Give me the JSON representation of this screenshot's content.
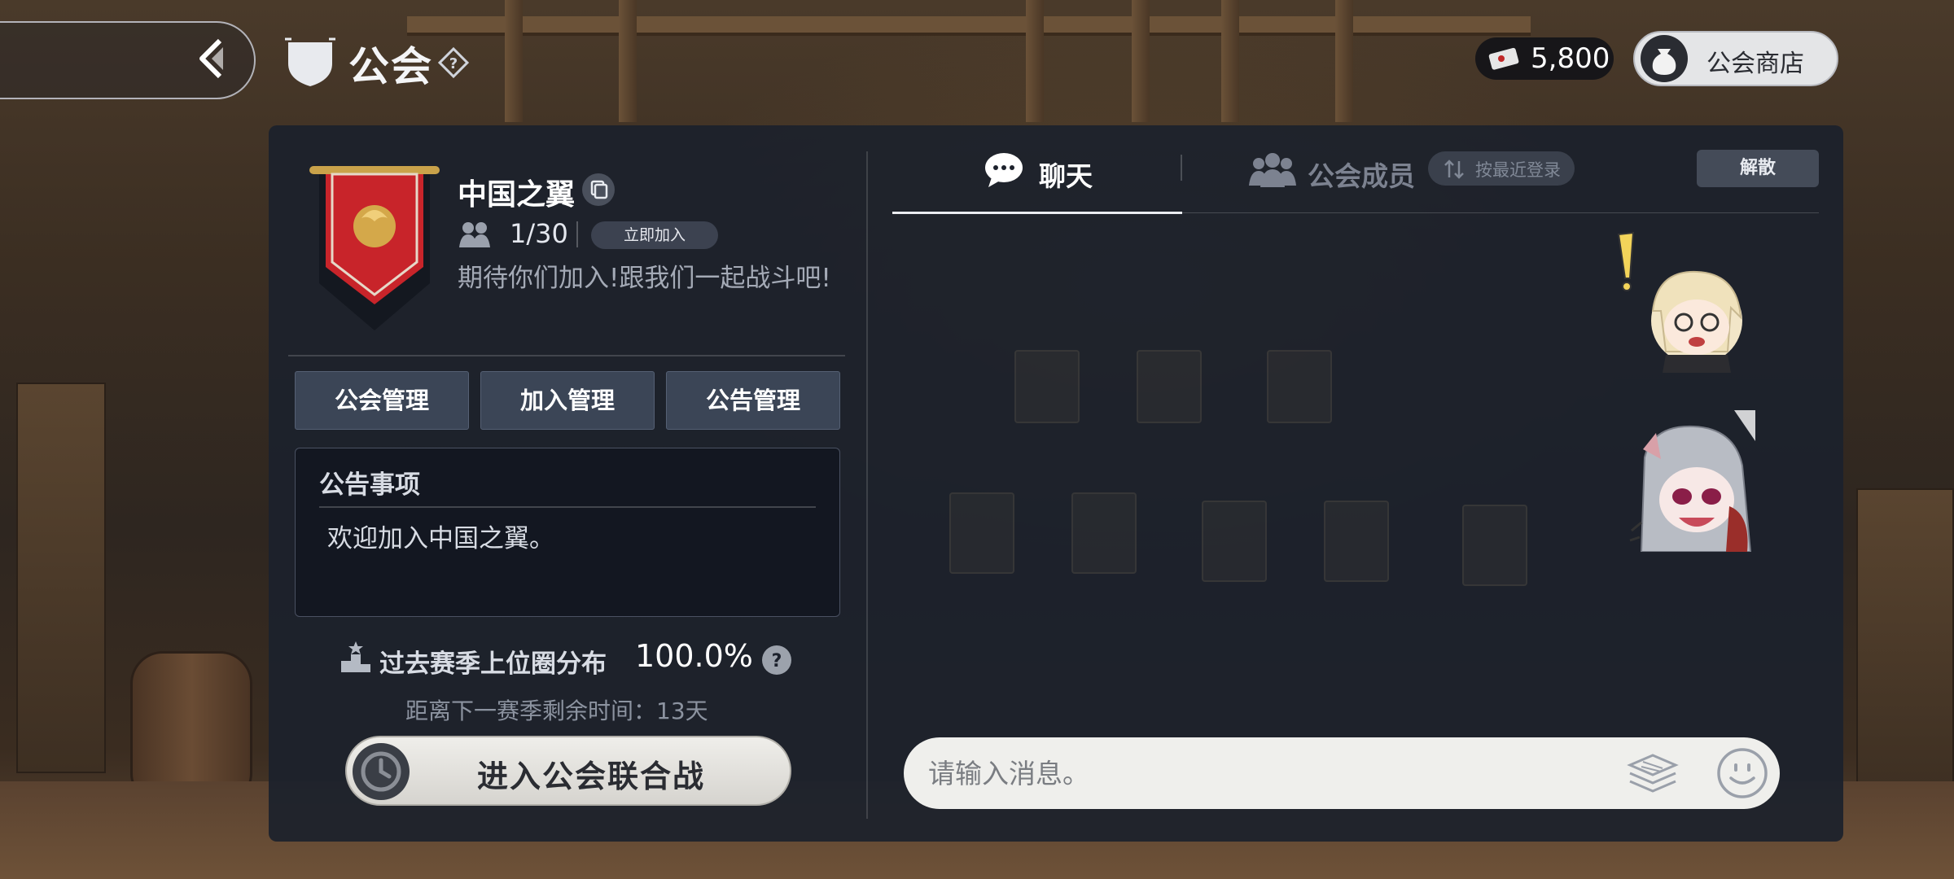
{
  "header": {
    "title": "公会",
    "currency_value": "5,800",
    "shop_label": "公会商店",
    "icons": [
      "back-arrow-icon",
      "guild-shield-icon",
      "help-icon",
      "ticket-icon",
      "money-bag-icon"
    ]
  },
  "guild": {
    "name": "中国之翼",
    "member_count": "1/30",
    "join_label": "立即加入",
    "description": "期待你们加入!跟我们一起战斗吧!"
  },
  "management_buttons": [
    {
      "label": "公会管理"
    },
    {
      "label": "加入管理"
    },
    {
      "label": "公告管理"
    }
  ],
  "notice": {
    "title": "公告事项",
    "body": "欢迎加入中国之翼。"
  },
  "ranking": {
    "label": "过去赛季上位圈分布",
    "value": "100.0%",
    "season_time": "距离下一赛季剩余时间：13天"
  },
  "war_button": {
    "label": "进入公会联合战"
  },
  "tabs": [
    {
      "label": "聊天",
      "active": true
    },
    {
      "label": "公会成员",
      "active": false
    }
  ],
  "sort_label": "按最近登录",
  "disband_label": "解散",
  "chat": {
    "placeholder": "请输入消息。",
    "messages": [
      {
        "type": "sticker",
        "icon": "blonde-girl-exclaim-sticker"
      },
      {
        "type": "sticker",
        "icon": "silver-hair-girl-sticker"
      }
    ]
  },
  "colors": {
    "panel_bg": "#1c212c",
    "button_bg": "#3b4556",
    "accent_banner": "#c8242a",
    "input_bg": "#efefec"
  }
}
